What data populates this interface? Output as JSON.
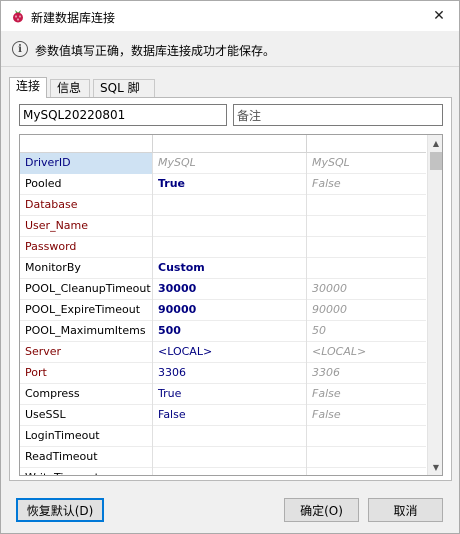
{
  "window": {
    "title": "新建数据库连接",
    "close_glyph": "✕"
  },
  "infobar": {
    "icon": "info-icon",
    "icon_glyph": "i",
    "message": "参数值填写正确，数据库连接成功才能保存。"
  },
  "tabs": [
    {
      "label": "连接",
      "active": true
    },
    {
      "label": "信息",
      "active": false
    },
    {
      "label": "SQL 脚本",
      "active": false
    }
  ],
  "connection": {
    "name_value": "MySQL20220801",
    "remark_value": "备注"
  },
  "grid": {
    "rows": [
      {
        "name": "DriverID",
        "value": "MySQL",
        "default": "MySQL",
        "name_style": "navy",
        "value_style": "gray",
        "selected": true
      },
      {
        "name": "Pooled",
        "value": "True",
        "default": "False",
        "name_style": "black",
        "value_style": "bold"
      },
      {
        "name": "Database",
        "value": "",
        "default": "",
        "name_style": "red",
        "value_style": "normal"
      },
      {
        "name": "User_Name",
        "value": "",
        "default": "",
        "name_style": "red",
        "value_style": "normal"
      },
      {
        "name": "Password",
        "value": "",
        "default": "",
        "name_style": "red",
        "value_style": "normal"
      },
      {
        "name": "MonitorBy",
        "value": "Custom",
        "default": "",
        "name_style": "black",
        "value_style": "bold"
      },
      {
        "name": "POOL_CleanupTimeout",
        "value": "30000",
        "default": "30000",
        "name_style": "black",
        "value_style": "bold"
      },
      {
        "name": "POOL_ExpireTimeout",
        "value": "90000",
        "default": "90000",
        "name_style": "black",
        "value_style": "bold"
      },
      {
        "name": "POOL_MaximumItems",
        "value": "500",
        "default": "50",
        "name_style": "black",
        "value_style": "bold"
      },
      {
        "name": "Server",
        "value": "<LOCAL>",
        "default": "<LOCAL>",
        "name_style": "red",
        "value_style": "normal"
      },
      {
        "name": "Port",
        "value": "3306",
        "default": "3306",
        "name_style": "red",
        "value_style": "normal"
      },
      {
        "name": "Compress",
        "value": "True",
        "default": "False",
        "name_style": "black",
        "value_style": "normal"
      },
      {
        "name": "UseSSL",
        "value": "False",
        "default": "False",
        "name_style": "black",
        "value_style": "normal"
      },
      {
        "name": "LoginTimeout",
        "value": "",
        "default": "",
        "name_style": "black",
        "value_style": "normal"
      },
      {
        "name": "ReadTimeout",
        "value": "",
        "default": "",
        "name_style": "black",
        "value_style": "normal"
      },
      {
        "name": "WriteTimeout",
        "value": "",
        "default": "",
        "name_style": "black",
        "value_style": "normal"
      }
    ],
    "scroll_up_glyph": "▲",
    "scroll_down_glyph": "▼"
  },
  "buttons": {
    "reset": "恢复默认(D)",
    "ok": "确定(O)",
    "cancel": "取消"
  },
  "colors": {
    "accent": "#0078d7",
    "selected_row": "#cfe2f3",
    "required_param": "#800000",
    "value_text": "#000080"
  }
}
